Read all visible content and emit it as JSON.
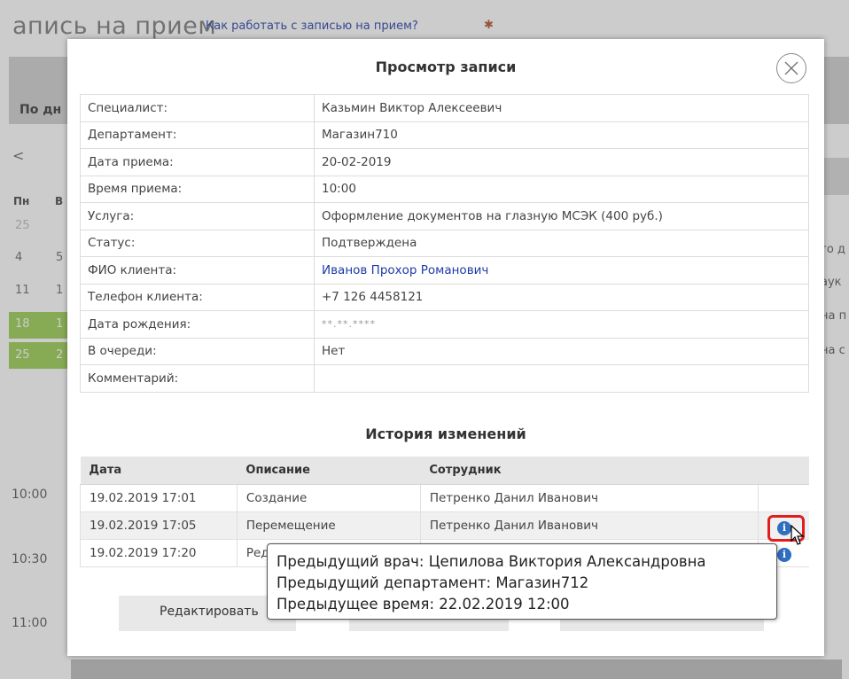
{
  "background": {
    "page_title": "апись на прием",
    "help_link": "Как работать с записью на прием?",
    "help_icon": "settings-icon",
    "view_toggle": "По дн",
    "nav_arrow": "<",
    "weekdays": [
      "Пн",
      "В"
    ],
    "dates_col1": [
      "25",
      "4",
      "11",
      "18",
      "25"
    ],
    "dates_col2": [
      "5",
      "1",
      "1",
      "2"
    ],
    "times": [
      "10:00",
      "10:30",
      "11:00"
    ],
    "right_texts": [
      "го д",
      "аук",
      "на п",
      "на с"
    ]
  },
  "modal": {
    "title": "Просмотр записи",
    "close_icon": "close-circle-icon",
    "details": [
      {
        "key": "Специалист:",
        "value": "Казьмин Виктор Алексеевич"
      },
      {
        "key": "Департамент:",
        "value": "Магазин710"
      },
      {
        "key": "Дата приема:",
        "value": "20-02-2019"
      },
      {
        "key": "Время приема:",
        "value": "10:00"
      },
      {
        "key": "Услуга:",
        "value": "Оформление документов на глазную МСЭК (400 руб.)"
      },
      {
        "key": "Статус:",
        "value": "Подтверждена"
      },
      {
        "key": "ФИО клиента:",
        "value": "Иванов Прохор Романович"
      },
      {
        "key": "Телефон клиента:",
        "value": "+7 126 4458121"
      },
      {
        "key": "Дата рождения:",
        "value": "**.**.****"
      },
      {
        "key": "В очереди:",
        "value": "Нет"
      },
      {
        "key": "Комментарий:",
        "value": ""
      }
    ],
    "history_title": "История изменений",
    "history_headers": [
      "Дата",
      "Описание",
      "Сотрудник"
    ],
    "history_rows": [
      {
        "date": "19.02.2019 17:01",
        "desc": "Создание",
        "employee": "Петренко Данил Иванович"
      },
      {
        "date": "19.02.2019 17:05",
        "desc": "Перемещение",
        "employee": "Петренко Данил Иванович"
      },
      {
        "date": "19.02.2019 17:20",
        "desc": "Ред",
        "employee": ""
      }
    ],
    "edit_button": "Редактировать",
    "info_icon": "info-icon"
  },
  "tooltip": {
    "lines": [
      "Предыдущий врач: Цепилова Виктория Александровна",
      "Предыдущий департамент: Магазин712",
      "Предыдущее время: 22.02.2019 12:00"
    ]
  },
  "colors": {
    "link": "#1f3aa8",
    "highlight": "#e01e1e",
    "calendar_green": "#9acd4f",
    "info_icon": "#2f6fc0"
  }
}
